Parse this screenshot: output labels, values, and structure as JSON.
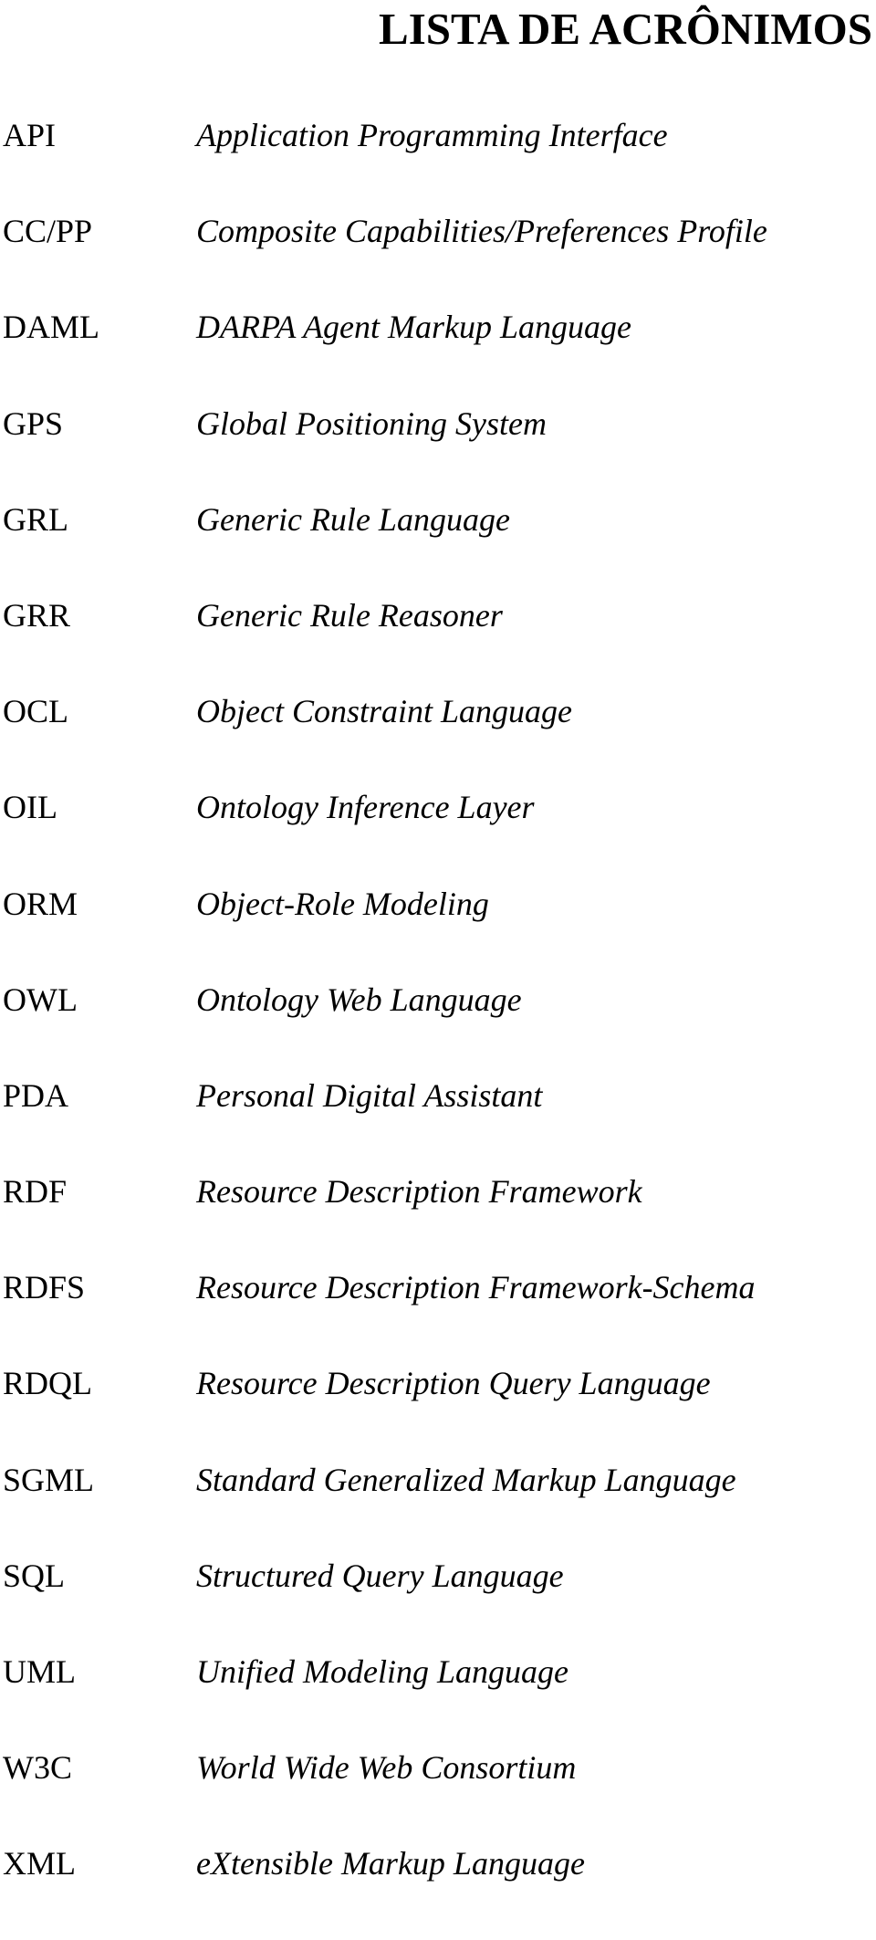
{
  "page": {
    "title": "LISTA DE ACRÔNIMOS"
  },
  "acronyms": [
    {
      "abbr": "API",
      "meaning": "Application Programming Interface"
    },
    {
      "abbr": "CC/PP",
      "meaning": "Composite Capabilities/Preferences Profile"
    },
    {
      "abbr": "DAML",
      "meaning": "DARPA Agent Markup Language"
    },
    {
      "abbr": "GPS",
      "meaning": "Global Positioning System"
    },
    {
      "abbr": "GRL",
      "meaning": "Generic Rule Language"
    },
    {
      "abbr": "GRR",
      "meaning": "Generic Rule Reasoner"
    },
    {
      "abbr": "OCL",
      "meaning": "Object Constraint Language"
    },
    {
      "abbr": "OIL",
      "meaning": "Ontology Inference Layer"
    },
    {
      "abbr": "ORM",
      "meaning": "Object-Role Modeling"
    },
    {
      "abbr": "OWL",
      "meaning": "Ontology Web Language"
    },
    {
      "abbr": "PDA",
      "meaning": "Personal Digital Assistant"
    },
    {
      "abbr": "RDF",
      "meaning": "Resource Description Framework"
    },
    {
      "abbr": "RDFS",
      "meaning": "Resource Description Framework-Schema"
    },
    {
      "abbr": "RDQL",
      "meaning": "Resource Description Query Language"
    },
    {
      "abbr": "SGML",
      "meaning": "Standard Generalized Markup Language"
    },
    {
      "abbr": "SQL",
      "meaning": "Structured Query Language"
    },
    {
      "abbr": "UML",
      "meaning": "Unified Modeling Language"
    },
    {
      "abbr": "W3C",
      "meaning": "World Wide Web Consortium"
    },
    {
      "abbr": "XML",
      "meaning": "eXtensible Markup Language"
    }
  ]
}
